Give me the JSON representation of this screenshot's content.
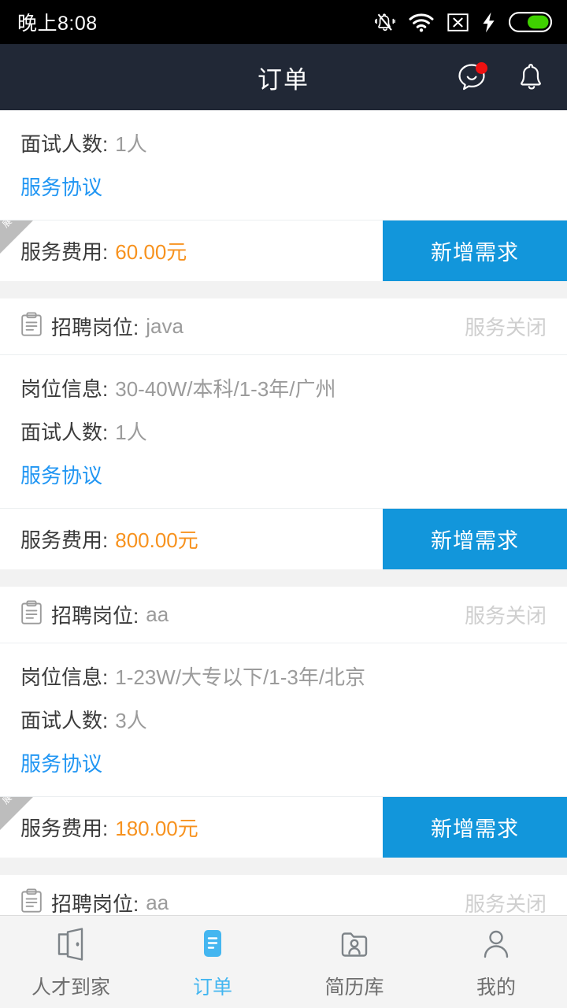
{
  "status_bar": {
    "time": "晚上8:08",
    "icons": [
      "mute-bell-icon",
      "wifi-icon",
      "sim-x-icon",
      "charging-bolt-icon",
      "battery-icon"
    ]
  },
  "header": {
    "title": "订单",
    "chat_icon": "smiley-chat-icon",
    "chat_has_badge": true,
    "bell_icon": "bell-icon"
  },
  "colors": {
    "header_bg": "#212836",
    "accent_blue": "#1296db",
    "link_blue": "#2196f3",
    "price_orange": "#f7921e",
    "page_bg": "#f2f2f2",
    "tab_active": "#44b6f0"
  },
  "labels": {
    "position": "招聘岗位:",
    "job_info": "岗位信息:",
    "interview_count": "面试人数:",
    "agreement": "服务协议",
    "fee": "服务费用:",
    "service_closed": "服务关闭",
    "add_requirement": "新增需求",
    "ribbon": "展"
  },
  "orders": [
    {
      "partial_top": true,
      "interview_count": "1人",
      "agreement": "服务协议",
      "fee": "60.00元",
      "has_ribbon": true,
      "action": "新增需求"
    },
    {
      "position": "java",
      "status": "服务关闭",
      "job_info": "30-40W/本科/1-3年/广州",
      "interview_count": "1人",
      "agreement": "服务协议",
      "fee": "800.00元",
      "has_ribbon": false,
      "action": "新增需求"
    },
    {
      "position": "aa",
      "status": "服务关闭",
      "job_info": "1-23W/大专以下/1-3年/北京",
      "interview_count": "3人",
      "agreement": "服务协议",
      "fee": "180.00元",
      "has_ribbon": true,
      "action": "新增需求"
    },
    {
      "position": "aa",
      "status": "服务关闭",
      "partial_bottom": true
    }
  ],
  "tabbar": {
    "items": [
      {
        "label": "人才到家",
        "icon": "open-door-icon",
        "active": false
      },
      {
        "label": "订单",
        "icon": "order-document-icon",
        "active": true
      },
      {
        "label": "简历库",
        "icon": "resume-folder-icon",
        "active": false
      },
      {
        "label": "我的",
        "icon": "person-icon",
        "active": false
      }
    ]
  }
}
